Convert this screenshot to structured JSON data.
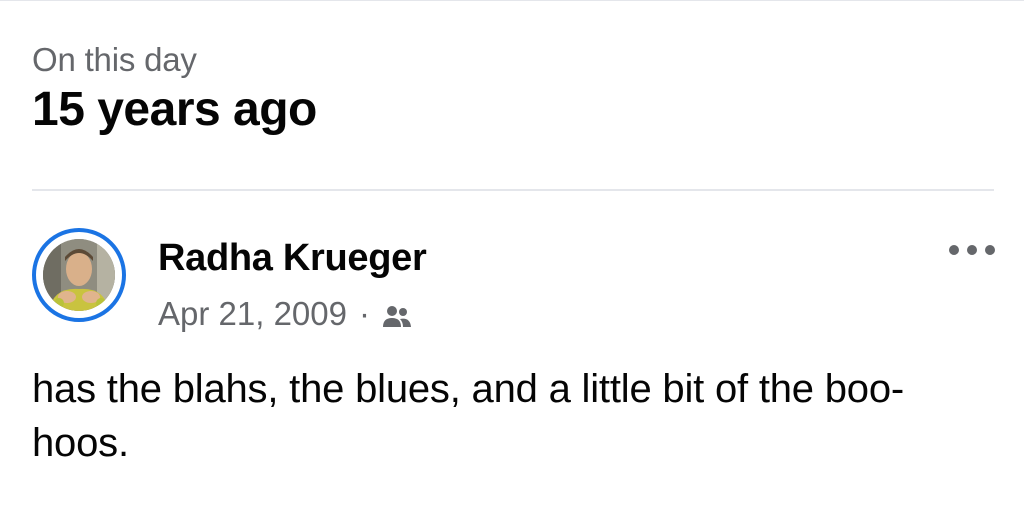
{
  "memory": {
    "kicker": "On this day",
    "title": "15 years ago"
  },
  "post": {
    "author": "Radha Krueger",
    "date": "Apr 21, 2009",
    "separator": "·",
    "audience_icon": "friends-icon",
    "more_icon": "more-options-icon",
    "text": "has the blahs, the blues, and a little bit of the boo-hoos."
  },
  "colors": {
    "accent": "#1b74e4",
    "secondary_text": "#65676b",
    "primary_text": "#050505",
    "divider": "#e4e6eb"
  }
}
